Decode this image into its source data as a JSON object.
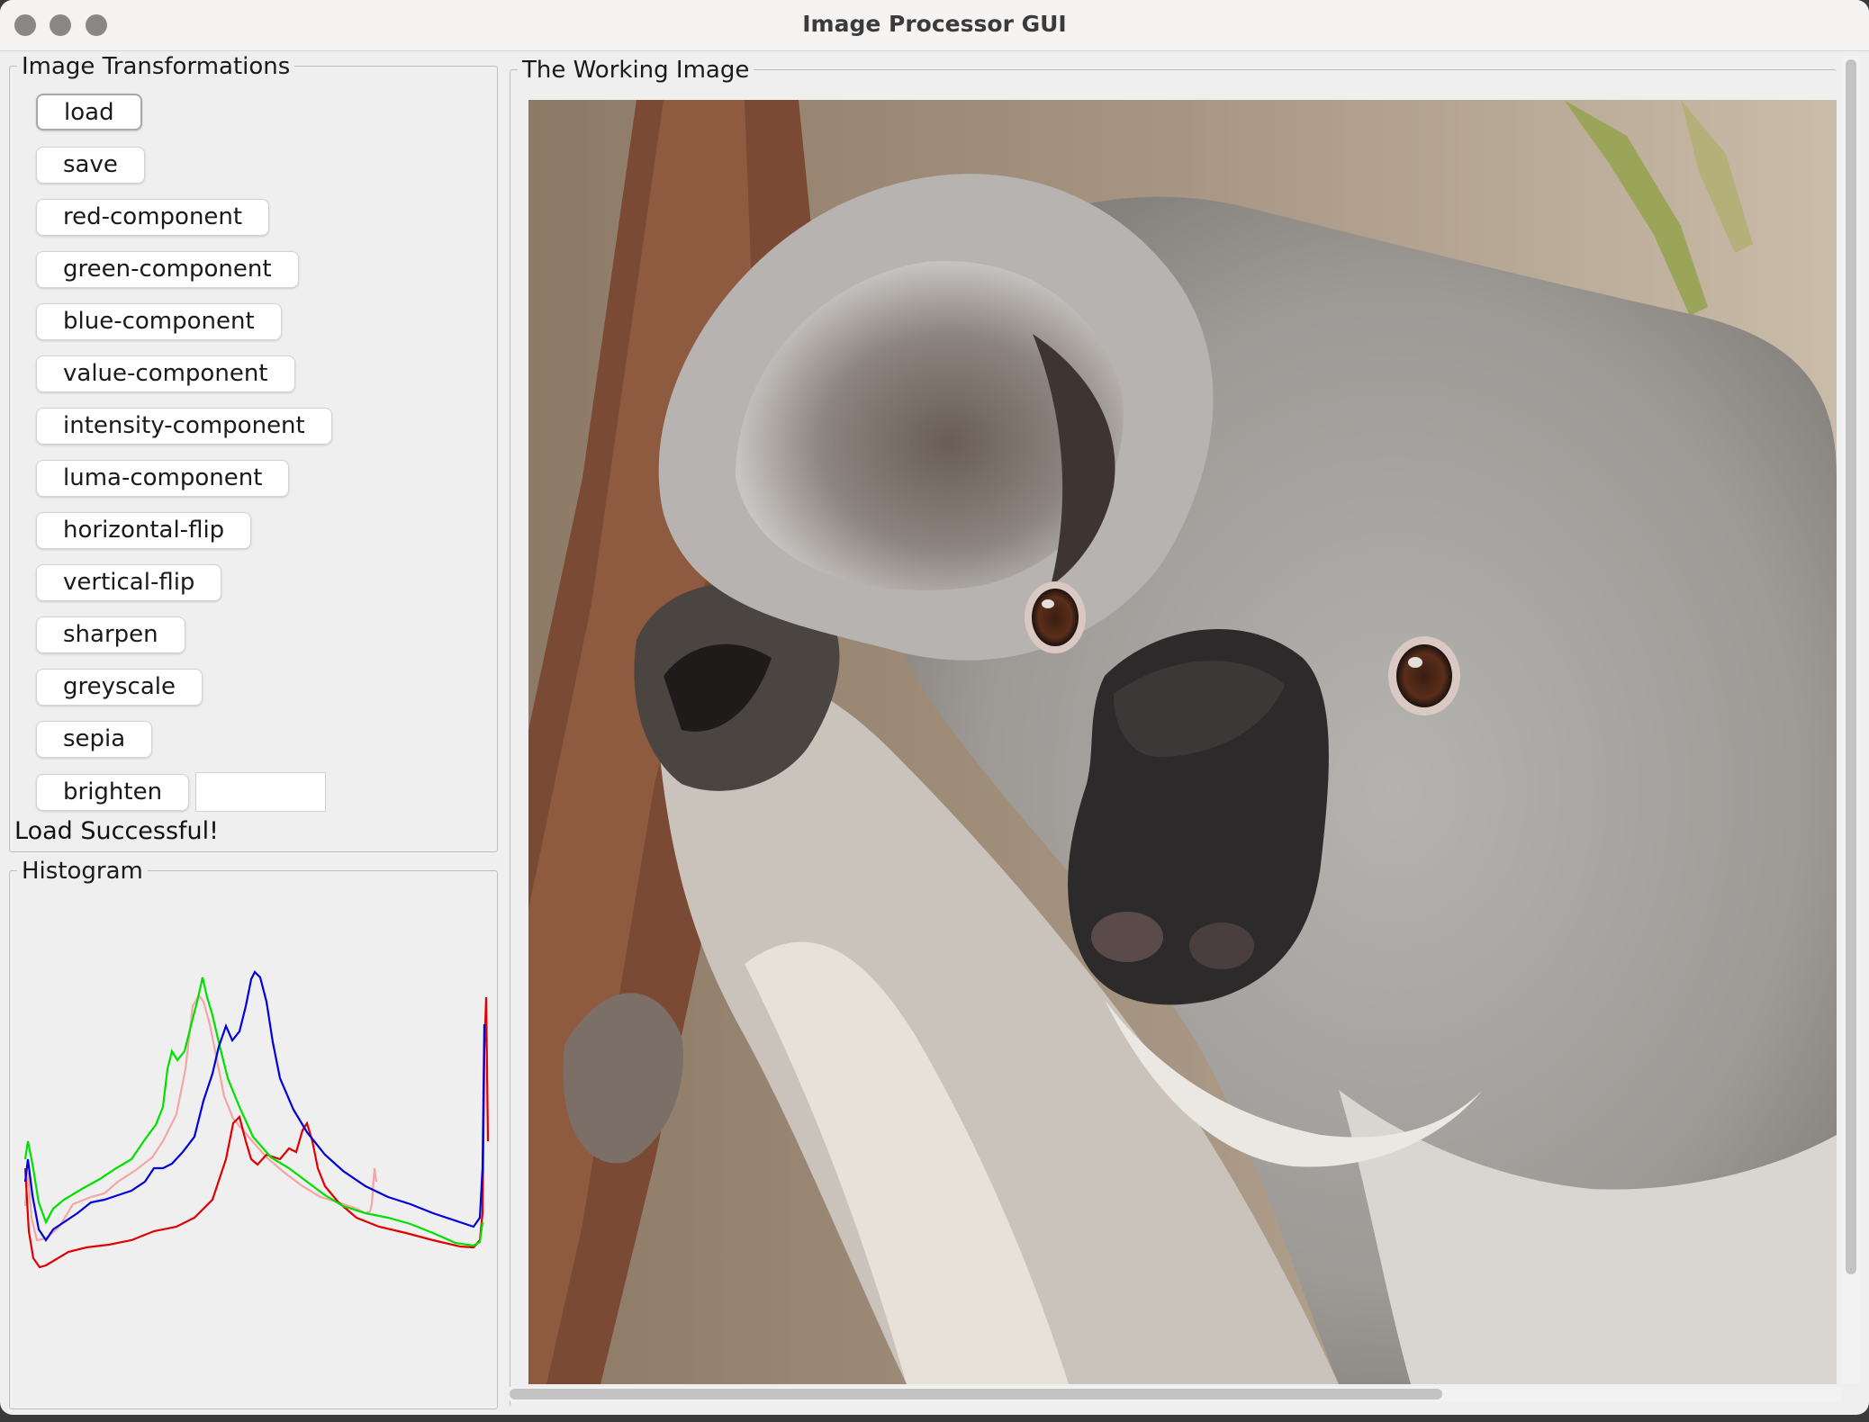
{
  "window": {
    "title": "Image Processor GUI"
  },
  "transformations": {
    "legend": "Image Transformations",
    "buttons": [
      "load",
      "save",
      "red-component",
      "green-component",
      "blue-component",
      "value-component",
      "intensity-component",
      "luma-component",
      "horizontal-flip",
      "vertical-flip",
      "sharpen",
      "greyscale",
      "sepia",
      "brighten"
    ],
    "brighten_value": "",
    "status": "Load Successful!"
  },
  "histogram": {
    "legend": "Histogram",
    "series_colors": {
      "red": "#e00000",
      "green": "#00e000",
      "blue": "#0000dd",
      "intensity": "#f4a6a6"
    }
  },
  "working_image": {
    "legend": "The Working Image",
    "subject_icon": "koala-photo"
  },
  "colors": {
    "window_bg": "#efefef",
    "titlebar_bg": "#f6f3f3"
  }
}
